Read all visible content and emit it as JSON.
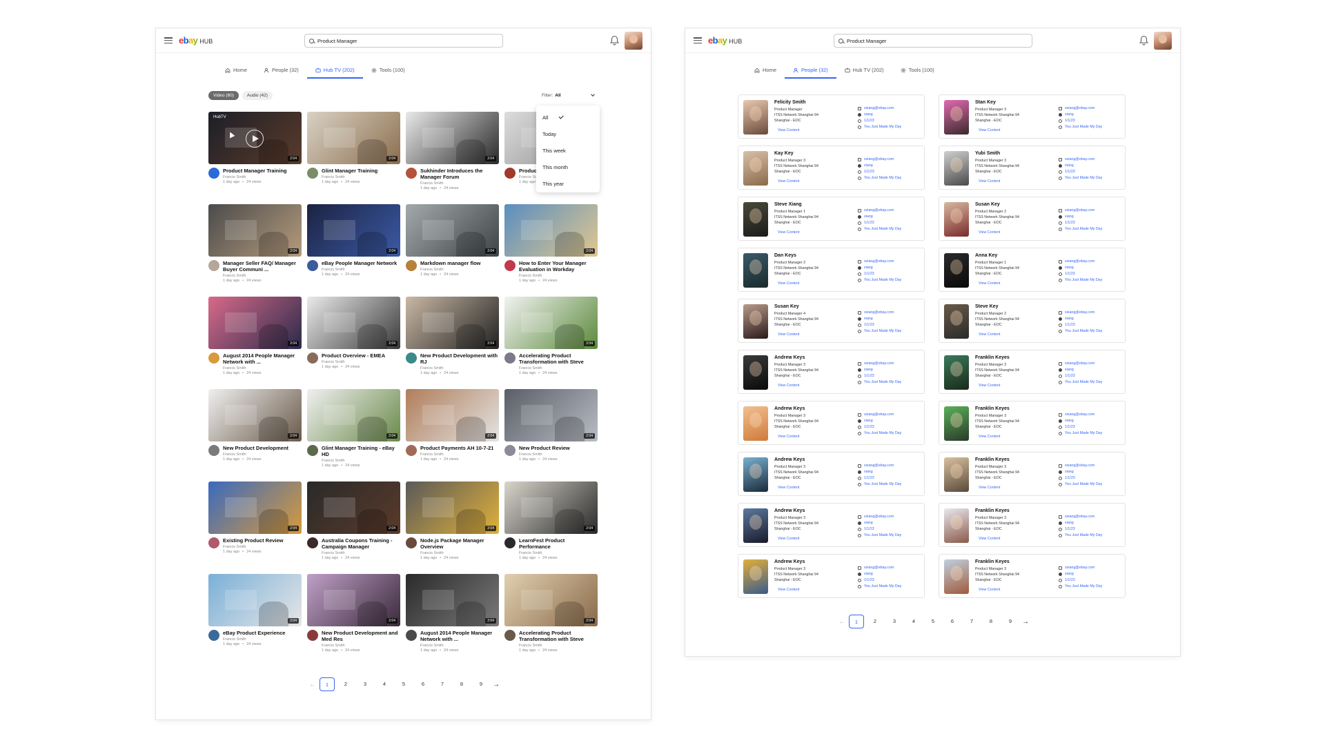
{
  "app": {
    "logo_e": "e",
    "logo_b": "b",
    "logo_a": "a",
    "logo_y": "y",
    "logo_hub": "HUB"
  },
  "search": {
    "value": "Product Manager"
  },
  "left": {
    "tabs": [
      {
        "label": "Home",
        "icon": "home-icon"
      },
      {
        "label": "People (32)",
        "icon": "people-icon"
      },
      {
        "label": "Hub TV (202)",
        "icon": "tv-icon",
        "active": true
      },
      {
        "label": "Tools (100)",
        "icon": "gear-icon"
      }
    ],
    "chips": [
      "Video (60)",
      "Audio (42)"
    ],
    "filter": {
      "label": "Filter:",
      "value": "All"
    },
    "dropdown": [
      "All",
      "Today",
      "This week",
      "This month",
      "This year"
    ],
    "hub_label": "HubTV",
    "videos": [
      {
        "title": "Product Manager Training",
        "author": "Francis Smith",
        "age": "1 day ago",
        "views": "24 views",
        "duration": "2:04",
        "c1": "#1d1f28",
        "c2": "#5a3b2a",
        "av": "#2b6bd8"
      },
      {
        "title": "Glint Manager Training",
        "author": "Francis Smith",
        "age": "1 day ago",
        "views": "24 views",
        "duration": "2:04",
        "c1": "#d9d2c4",
        "c2": "#8c6e4e",
        "av": "#7a8c6a"
      },
      {
        "title": "Sukhinder Introduces the Manager Forum",
        "author": "Francis Smith",
        "age": "1 day ago",
        "views": "24 views",
        "duration": "2:04",
        "c1": "#e9e9e9",
        "c2": "#2a2a2a",
        "av": "#b5523a"
      },
      {
        "title": "Product Manager Training",
        "author": "Francis Smith",
        "age": "1 day ago",
        "views": "24 views",
        "duration": "2:04",
        "c1": "#dcdcdc",
        "c2": "#8a8a8a",
        "av": "#a03a2a"
      },
      {
        "title": "Manager Seller FAQ/ Manager Buyer Communi ...",
        "author": "Francis Smith",
        "age": "1 day ago",
        "views": "24 views",
        "duration": "2:04",
        "c1": "#4b4b4b",
        "c2": "#b59b7c",
        "av": "#b5a59a"
      },
      {
        "title": "eBay People Manager Network",
        "author": "Francis Smith",
        "age": "1 day ago",
        "views": "24 views",
        "duration": "2:04",
        "c1": "#1c2342",
        "c2": "#3b5aa6",
        "av": "#3a5c9a"
      },
      {
        "title": "Markdown manager flow",
        "author": "Francis Smith",
        "age": "1 day ago",
        "views": "24 views",
        "duration": "2:04",
        "c1": "#a4a9ab",
        "c2": "#3e4446",
        "av": "#b5823a"
      },
      {
        "title": "How to Enter Your Manager Evaluation in Workday",
        "author": "Francis Smith",
        "age": "1 day ago",
        "views": "24 views",
        "duration": "2:04",
        "c1": "#5a8ec0",
        "c2": "#e0c78f",
        "av": "#c23a4a"
      },
      {
        "title": "August 2014 People Manager Network with ...",
        "author": "Francis Smith",
        "age": "1 day ago",
        "views": "24 views",
        "duration": "2:04",
        "c1": "#d86a8a",
        "c2": "#2a2a4a",
        "av": "#d89a3a"
      },
      {
        "title": "Product Overview - EMEA",
        "author": "Francis Smith",
        "age": "1 day ago",
        "views": "24 views",
        "duration": "2:04",
        "c1": "#eaeaea",
        "c2": "#3a3a3a",
        "av": "#8a6a5a"
      },
      {
        "title": "New Product Development with RJ",
        "author": "Francis Smith",
        "age": "1 day ago",
        "views": "24 views",
        "duration": "2:04",
        "c1": "#c9b8a5",
        "c2": "#222222",
        "av": "#3a8a8a"
      },
      {
        "title": "Accelerating Product Transformation with Steve",
        "author": "Francis Smith",
        "age": "1 day ago",
        "views": "24 views",
        "duration": "2:04",
        "c1": "#f2f2f2",
        "c2": "#5a8a3a",
        "av": "#7a7a8a"
      },
      {
        "title": "New Product Development",
        "author": "Francis Smith",
        "age": "1 day ago",
        "views": "24 views",
        "duration": "2:04",
        "c1": "#efefef",
        "c2": "#6a5a4a",
        "av": "#7a7a7a"
      },
      {
        "title": "Glint Manager Training - eBay HD",
        "author": "Francis Smith",
        "age": "1 day ago",
        "views": "24 views",
        "duration": "2:04",
        "c1": "#f0f0f0",
        "c2": "#6a8a4a",
        "av": "#5a6a4a"
      },
      {
        "title": "Product Payments AH 10-7-21",
        "author": "Francis Smith",
        "age": "1 day ago",
        "views": "24 views",
        "duration": "2:04",
        "c1": "#b07e5a",
        "c2": "#e3e3e3",
        "av": "#a06a5a"
      },
      {
        "title": "New Product Review",
        "author": "Francis Smith",
        "age": "1 day ago",
        "views": "24 views",
        "duration": "2:04",
        "c1": "#5a5e66",
        "c2": "#b8bcc4",
        "av": "#8a8a9a"
      },
      {
        "title": "Existing Product Review",
        "author": "Francis Smith",
        "age": "1 day ago",
        "views": "24 views",
        "duration": "2:04",
        "c1": "#3a6ac0",
        "c2": "#d89a3a",
        "av": "#b05a6a"
      },
      {
        "title": "Australia Coupons Training - Campaign Manager",
        "author": "Francis Smith",
        "age": "1 day ago",
        "views": "24 views",
        "duration": "2:04",
        "c1": "#2a2a2a",
        "c2": "#5a3a2a",
        "av": "#3a2a2a"
      },
      {
        "title": "Node.js Package Manager Overview",
        "author": "Francis Smith",
        "age": "1 day ago",
        "views": "24 views",
        "duration": "2:04",
        "c1": "#5a5a5a",
        "c2": "#e0b03a",
        "av": "#6a4a3a"
      },
      {
        "title": "LearnFest Product Performance",
        "author": "Francis Smith",
        "age": "1 day ago",
        "views": "24 views",
        "duration": "2:04",
        "c1": "#d9d5cc",
        "c2": "#2a2a2a",
        "av": "#2a2a2a"
      },
      {
        "title": "eBay Product Experience",
        "author": "Francis Smith",
        "age": "1 day ago",
        "views": "24 views",
        "duration": "2:04",
        "c1": "#7ab0d8",
        "c2": "#e6e6e6",
        "av": "#3a6a9a"
      },
      {
        "title": "New Product Development and Med Res",
        "author": "Francis Smith",
        "age": "1 day ago",
        "views": "24 views",
        "duration": "2:04",
        "c1": "#c0a0c8",
        "c2": "#3a2a3a",
        "av": "#8a3a3a"
      },
      {
        "title": "August 2014 People Manager Network with ...",
        "author": "Francis Smith",
        "age": "1 day ago",
        "views": "24 views",
        "duration": "2:04",
        "c1": "#2a2a2a",
        "c2": "#7a7a7a",
        "av": "#4a4a4a"
      },
      {
        "title": "Accelerating Product Transformation with Steve",
        "author": "Francis Smith",
        "age": "1 day ago",
        "views": "24 views",
        "duration": "2:04",
        "c1": "#e0d0b0",
        "c2": "#8a6a4a",
        "av": "#6a5a4a"
      }
    ],
    "pages": [
      "1",
      "2",
      "3",
      "4",
      "5",
      "6",
      "7",
      "8",
      "9"
    ]
  },
  "right": {
    "tabs": [
      {
        "label": "Home",
        "icon": "home-icon"
      },
      {
        "label": "People (32)",
        "icon": "people-icon",
        "active": true
      },
      {
        "label": "Hub TV (202)",
        "icon": "tv-icon"
      },
      {
        "label": "Tools (100)",
        "icon": "gear-icon"
      }
    ],
    "view_label": "View Content",
    "people": [
      {
        "name": "Felicity Smith",
        "title": "Product Manager",
        "org": "ITSS Network Shanghai 94",
        "loc": "Shanghai - EOC",
        "email": "sxiang@ebay.com",
        "user": "xiang",
        "code": "1/1/23",
        "note": "You Just Made My Day",
        "c1": "#e8c8b0",
        "c2": "#6a4a3a"
      },
      {
        "name": "Stan Key",
        "title": "Product Manager 3",
        "org": "ITSS Network Shanghai 94",
        "loc": "Shanghai - EOC",
        "email": "sxiang@ebay.com",
        "user": "xiang",
        "code": "1/1/23",
        "note": "You Just Made My Day",
        "c1": "#e06ab0",
        "c2": "#3a2a2a"
      },
      {
        "name": "Kay Key",
        "title": "Product Manager 3",
        "org": "ITSS Network Shanghai 94",
        "loc": "Shanghai - EOC",
        "email": "sxiang@ebay.com",
        "user": "xiang",
        "code": "1/1/23",
        "note": "You Just Made My Day",
        "c1": "#d8c0a8",
        "c2": "#8a6a4a"
      },
      {
        "name": "Yubi Smith",
        "title": "Product Manager 3",
        "org": "ITSS Network Shanghai 94",
        "loc": "Shanghai - EOC",
        "email": "sxiang@ebay.com",
        "user": "xiang",
        "code": "1/1/23",
        "note": "You Just Made My Day",
        "c1": "#cfcfcf",
        "c2": "#4a4a4a"
      },
      {
        "name": "Steve  Xiang",
        "title": "Product Manager 1",
        "org": "ITSS Network Shanghai 94",
        "loc": "Shanghai - EOC",
        "email": "sxiang@ebay.com",
        "user": "xiang",
        "code": "1/1/23",
        "note": "You Just Made My Day",
        "c1": "#4a4a3a",
        "c2": "#1a1a1a"
      },
      {
        "name": "Susan Key",
        "title": "Product Manager 2",
        "org": "ITSS Network Shanghai 94",
        "loc": "Shanghai - EOC",
        "email": "sxiang@ebay.com",
        "user": "xiang",
        "code": "1/1/23",
        "note": "You Just Made My Day",
        "c1": "#d8b8a0",
        "c2": "#7a2a2a"
      },
      {
        "name": "Dan Keys",
        "title": "Product Manager 2",
        "org": "ITSS Network Shanghai 94",
        "loc": "Shanghai - EOC",
        "email": "sxiang@ebay.com",
        "user": "xiang",
        "code": "1/1/23",
        "note": "You Just Made My Day",
        "c1": "#3a5a6a",
        "c2": "#1a2a2a"
      },
      {
        "name": "Anna Key",
        "title": "Product Manager 1",
        "org": "ITSS Network Shanghai 94",
        "loc": "Shanghai - EOC",
        "email": "sxiang@ebay.com",
        "user": "xiang",
        "code": "1/1/23",
        "note": "You Just Made My Day",
        "c1": "#2a2a2a",
        "c2": "#0a0a0a"
      },
      {
        "name": "Susan Key",
        "title": "Product Manager 4",
        "org": "ITSS Network Shanghai 94",
        "loc": "Shanghai - EOC",
        "email": "sxiang@ebay.com",
        "user": "xiang",
        "code": "1/1/23",
        "note": "You Just Made My Day",
        "c1": "#b89a8a",
        "c2": "#2a1a1a"
      },
      {
        "name": "Steve  Key",
        "title": "Product Manager 2",
        "org": "ITSS Network Shanghai 94",
        "loc": "Shanghai - EOC",
        "email": "sxiang@ebay.com",
        "user": "xiang",
        "code": "1/1/23",
        "note": "You Just Made My Day",
        "c1": "#6a5a4a",
        "c2": "#2a2a2a"
      },
      {
        "name": "Andrew  Keys",
        "title": "Product Manager 3",
        "org": "ITSS Network Shanghai 94",
        "loc": "Shanghai - EOC",
        "email": "sxiang@ebay.com",
        "user": "xiang",
        "code": "1/1/23",
        "note": "You Just Made My Day",
        "c1": "#3a3a3a",
        "c2": "#0a0a0a"
      },
      {
        "name": "Franklin Keyes",
        "title": "Product Manager 3",
        "org": "ITSS Network Shanghai 94",
        "loc": "Shanghai - EOC",
        "email": "sxiang@ebay.com",
        "user": "xiang",
        "code": "1/1/23",
        "note": "You Just Made My Day",
        "c1": "#3a7a5a",
        "c2": "#1a2a1a"
      },
      {
        "name": "Andrew  Keys",
        "title": "Product Manager 3",
        "org": "ITSS Network Shanghai 94",
        "loc": "Shanghai - EOC",
        "email": "sxiang@ebay.com",
        "user": "xiang",
        "code": "1/1/23",
        "note": "You Just Made My Day",
        "c1": "#f0c090",
        "c2": "#d07a3a"
      },
      {
        "name": "Franklin Keyes",
        "title": "Product Manager 3",
        "org": "ITSS Network Shanghai 94",
        "loc": "Shanghai - EOC",
        "email": "sxiang@ebay.com",
        "user": "xiang",
        "code": "1/1/23",
        "note": "You Just Made My Day",
        "c1": "#5ab05a",
        "c2": "#2a3a2a"
      },
      {
        "name": "Andrew  Keys",
        "title": "Product Manager 3",
        "org": "ITSS Network Shanghai 94",
        "loc": "Shanghai - EOC",
        "email": "sxiang@ebay.com",
        "user": "xiang",
        "code": "1/1/23",
        "note": "You Just Made My Day",
        "c1": "#7ab0d0",
        "c2": "#1a2a3a"
      },
      {
        "name": "Franklin Keyes",
        "title": "Product Manager 3",
        "org": "ITSS Network Shanghai 94",
        "loc": "Shanghai - EOC",
        "email": "sxiang@ebay.com",
        "user": "xiang",
        "code": "1/1/23",
        "note": "You Just Made My Day",
        "c1": "#d8c0a0",
        "c2": "#5a4a3a"
      },
      {
        "name": "Andrew  Keys",
        "title": "Product Manager 3",
        "org": "ITSS Network Shanghai 94",
        "loc": "Shanghai - EOC",
        "email": "sxiang@ebay.com",
        "user": "xiang",
        "code": "1/1/23",
        "note": "You Just Made My Day",
        "c1": "#5a7aa0",
        "c2": "#1a1a2a"
      },
      {
        "name": "Franklin Keyes",
        "title": "Product Manager 3",
        "org": "ITSS Network Shanghai 94",
        "loc": "Shanghai - EOC",
        "email": "sxiang@ebay.com",
        "user": "xiang",
        "code": "1/1/23",
        "note": "You Just Made My Day",
        "c1": "#e8e8f0",
        "c2": "#8a5a4a"
      },
      {
        "name": "Andrew  Keys",
        "title": "Product Manager 3",
        "org": "ITSS Network Shanghai 94",
        "loc": "Shanghai - EOC",
        "email": "sxiang@ebay.com",
        "user": "xiang",
        "code": "1/1/23",
        "note": "You Just Made My Day",
        "c1": "#e0b03a",
        "c2": "#3a5a8a"
      },
      {
        "name": "Franklin Keyes",
        "title": "Product Manager 3",
        "org": "ITSS Network Shanghai 94",
        "loc": "Shanghai - EOC",
        "email": "sxiang@ebay.com",
        "user": "xiang",
        "code": "1/1/23",
        "note": "You Just Made My Day",
        "c1": "#c0d0e0",
        "c2": "#a05a3a"
      }
    ],
    "pages": [
      "1",
      "2",
      "3",
      "4",
      "5",
      "6",
      "7",
      "8",
      "9"
    ]
  },
  "colors": {
    "accent": "#3665f3",
    "text": "#111111",
    "muted": "#888888"
  }
}
